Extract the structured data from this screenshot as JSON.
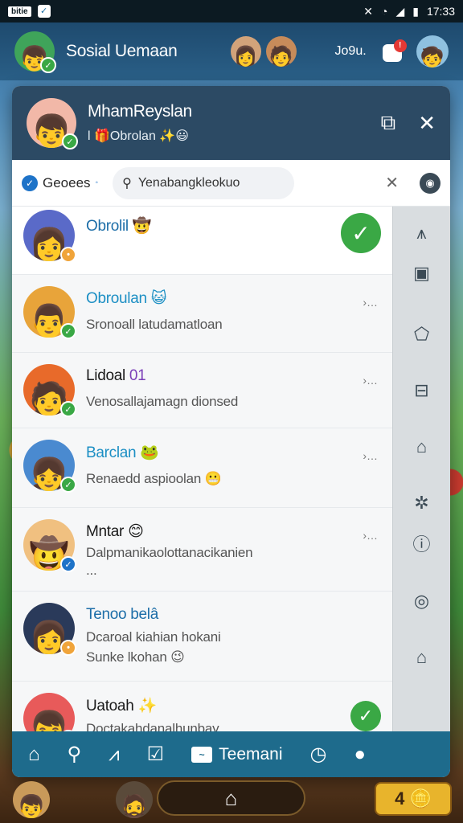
{
  "status_bar": {
    "app_name": "bitie",
    "time": "17:33"
  },
  "top_header": {
    "title": "Sosial Uemaan",
    "user_label": "Jo9u.",
    "notification_count": "!"
  },
  "chat_header": {
    "name": "MhamReyslan",
    "subtitle": "Obrolan"
  },
  "search": {
    "tab_label": "Geoees",
    "value": "Yenabangkleokuo"
  },
  "rows": [
    {
      "title": "Obrolil",
      "title_emoji": "🤠",
      "message": "",
      "state": "checked"
    },
    {
      "title": "Obroulan",
      "title_emoji": "😺",
      "message": "Sronoall latudamatloan",
      "state": "more"
    },
    {
      "title": "Lidoal",
      "title_extra": "01",
      "message": "Venosallajamagn dionsed",
      "state": "more"
    },
    {
      "title": "Barclan",
      "title_emoji": "🐸",
      "message": "Renaedd aspioolan",
      "message_emoji": "😬",
      "state": "more"
    },
    {
      "title": "Mntar",
      "title_emoji": "😊",
      "message": "Dalpmanikaolottanacikanien",
      "message2": "...",
      "state": "more"
    },
    {
      "title": "Tenoo belâ",
      "message": "Dcaroal kiahian hokani",
      "message2": "Sunke lkohan",
      "message2_emoji": "😉",
      "state": "none"
    },
    {
      "title": "Uatoah",
      "title_emoji": "✨",
      "message": "Doctakahdanalhunbay",
      "state": "checked"
    }
  ],
  "more_label": "›…",
  "bottom_nav": {
    "label": "Teemani"
  },
  "game_bottom": {
    "score": "4"
  },
  "colors": {
    "header_bg": "#2c4a64",
    "nav_bg": "#1e6b8c",
    "check_green": "#3aa845",
    "link_blue": "#1d6ea8"
  }
}
